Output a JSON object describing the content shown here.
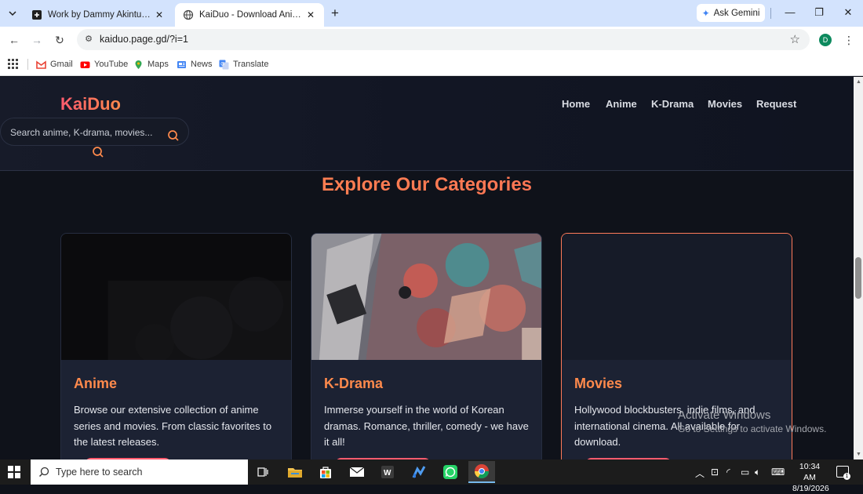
{
  "browser": {
    "tabs": [
      {
        "label": "Work by Dammy Akintunde",
        "active": false
      },
      {
        "label": "KaiDuo - Download Anime, K-Drama",
        "active": true
      }
    ],
    "ask_gemini": "Ask Gemini",
    "url": "kaiduo.page.gd/?i=1",
    "profile_initial": "D",
    "bookmarks": [
      "Gmail",
      "YouTube",
      "Maps",
      "News",
      "Translate"
    ]
  },
  "site": {
    "logo": "KaiDuo",
    "search_placeholder": "Search anime, K-drama, movies...",
    "nav": [
      "Home",
      "Anime",
      "K-Drama",
      "Movies",
      "Request"
    ],
    "section_title": "Explore Our Categories",
    "cards": [
      {
        "title": "Anime",
        "description": "Browse our extensive collection of anime series and movies. From classic favorites to the latest releases."
      },
      {
        "title": "K-Drama",
        "description": "Immerse yourself in the world of Korean dramas. Romance, thriller, comedy - we have it all!"
      },
      {
        "title": "Movies",
        "description": "Hollywood blockbusters, indie films, and international cinema. All available for download."
      }
    ]
  },
  "watermark": {
    "line1": "Activate Windows",
    "line2": "Go to Settings to activate Windows."
  },
  "taskbar": {
    "search_placeholder": "Type here to search",
    "time": "10:34 AM",
    "date": "8/19/2026",
    "notification_count": "1"
  },
  "colors": {
    "accent": "#ff7f50",
    "logo": "#ff5b6e",
    "card_bg": "#1c2233",
    "page_bg": "#0f121a"
  }
}
